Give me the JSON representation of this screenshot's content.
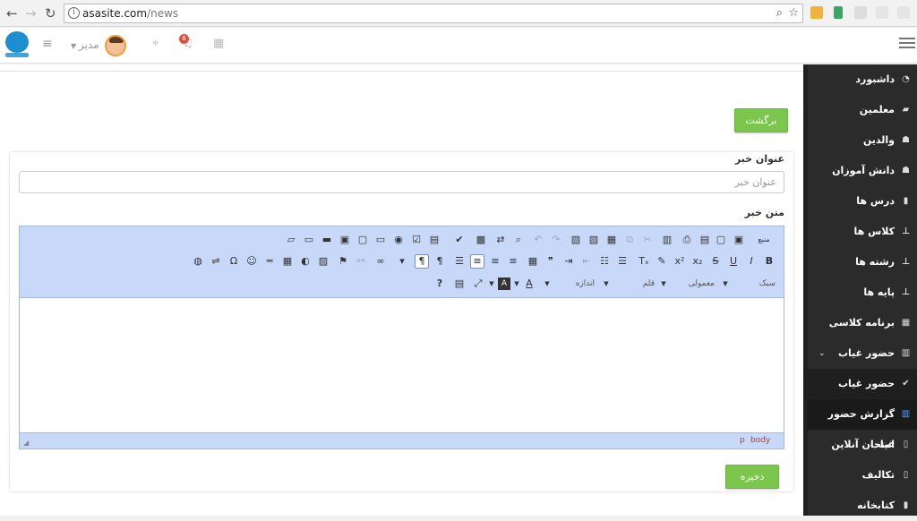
{
  "browser": {
    "url_domain": "asasite.com",
    "url_path": "/news"
  },
  "header": {
    "user_role": "مدیر",
    "notification_count": "6"
  },
  "page": {
    "back_button": "برگشت",
    "title_label": "عنوان خبر",
    "title_placeholder": "عنوان خبر",
    "body_label": "متن خبر",
    "save_button": "ذخیره"
  },
  "editor": {
    "source_label": "منبع",
    "style_label": "سبک",
    "format_label": "معمولی",
    "font_label": "قلم",
    "size_label": "اندازه",
    "path_items": [
      "body",
      "p"
    ]
  },
  "sidebar": {
    "items": [
      {
        "label": "داشبورد",
        "icon": "dashboard-icon"
      },
      {
        "label": "معلمین",
        "icon": "briefcase-icon"
      },
      {
        "label": "والدین",
        "icon": "users-icon"
      },
      {
        "label": "دانش آموزان",
        "icon": "users-icon"
      },
      {
        "label": "درس ها",
        "icon": "book-icon"
      },
      {
        "label": "کلاس ها",
        "icon": "sitemap-icon"
      },
      {
        "label": "رشته ها",
        "icon": "sitemap-icon"
      },
      {
        "label": "پایه ها",
        "icon": "sitemap-icon"
      },
      {
        "label": "برنامه کلاسی",
        "icon": "table-icon"
      },
      {
        "label": "حضور غیاب",
        "icon": "bar-chart-icon"
      },
      {
        "label": "حضور غیاب",
        "icon": "check-icon"
      },
      {
        "label": "گزارش حضور غیاب",
        "icon": "bar-chart-icon"
      },
      {
        "label": "امتحان آنلاین",
        "icon": "file-icon"
      },
      {
        "label": "تکالیف",
        "icon": "pdf-file-icon"
      },
      {
        "label": "کتابخانه",
        "icon": "book-icon"
      }
    ]
  },
  "colors": {
    "accent_green": "#7bc74d",
    "sidebar_bg": "#2b2b2b",
    "toolbar_bg": "#c8d8f8"
  }
}
